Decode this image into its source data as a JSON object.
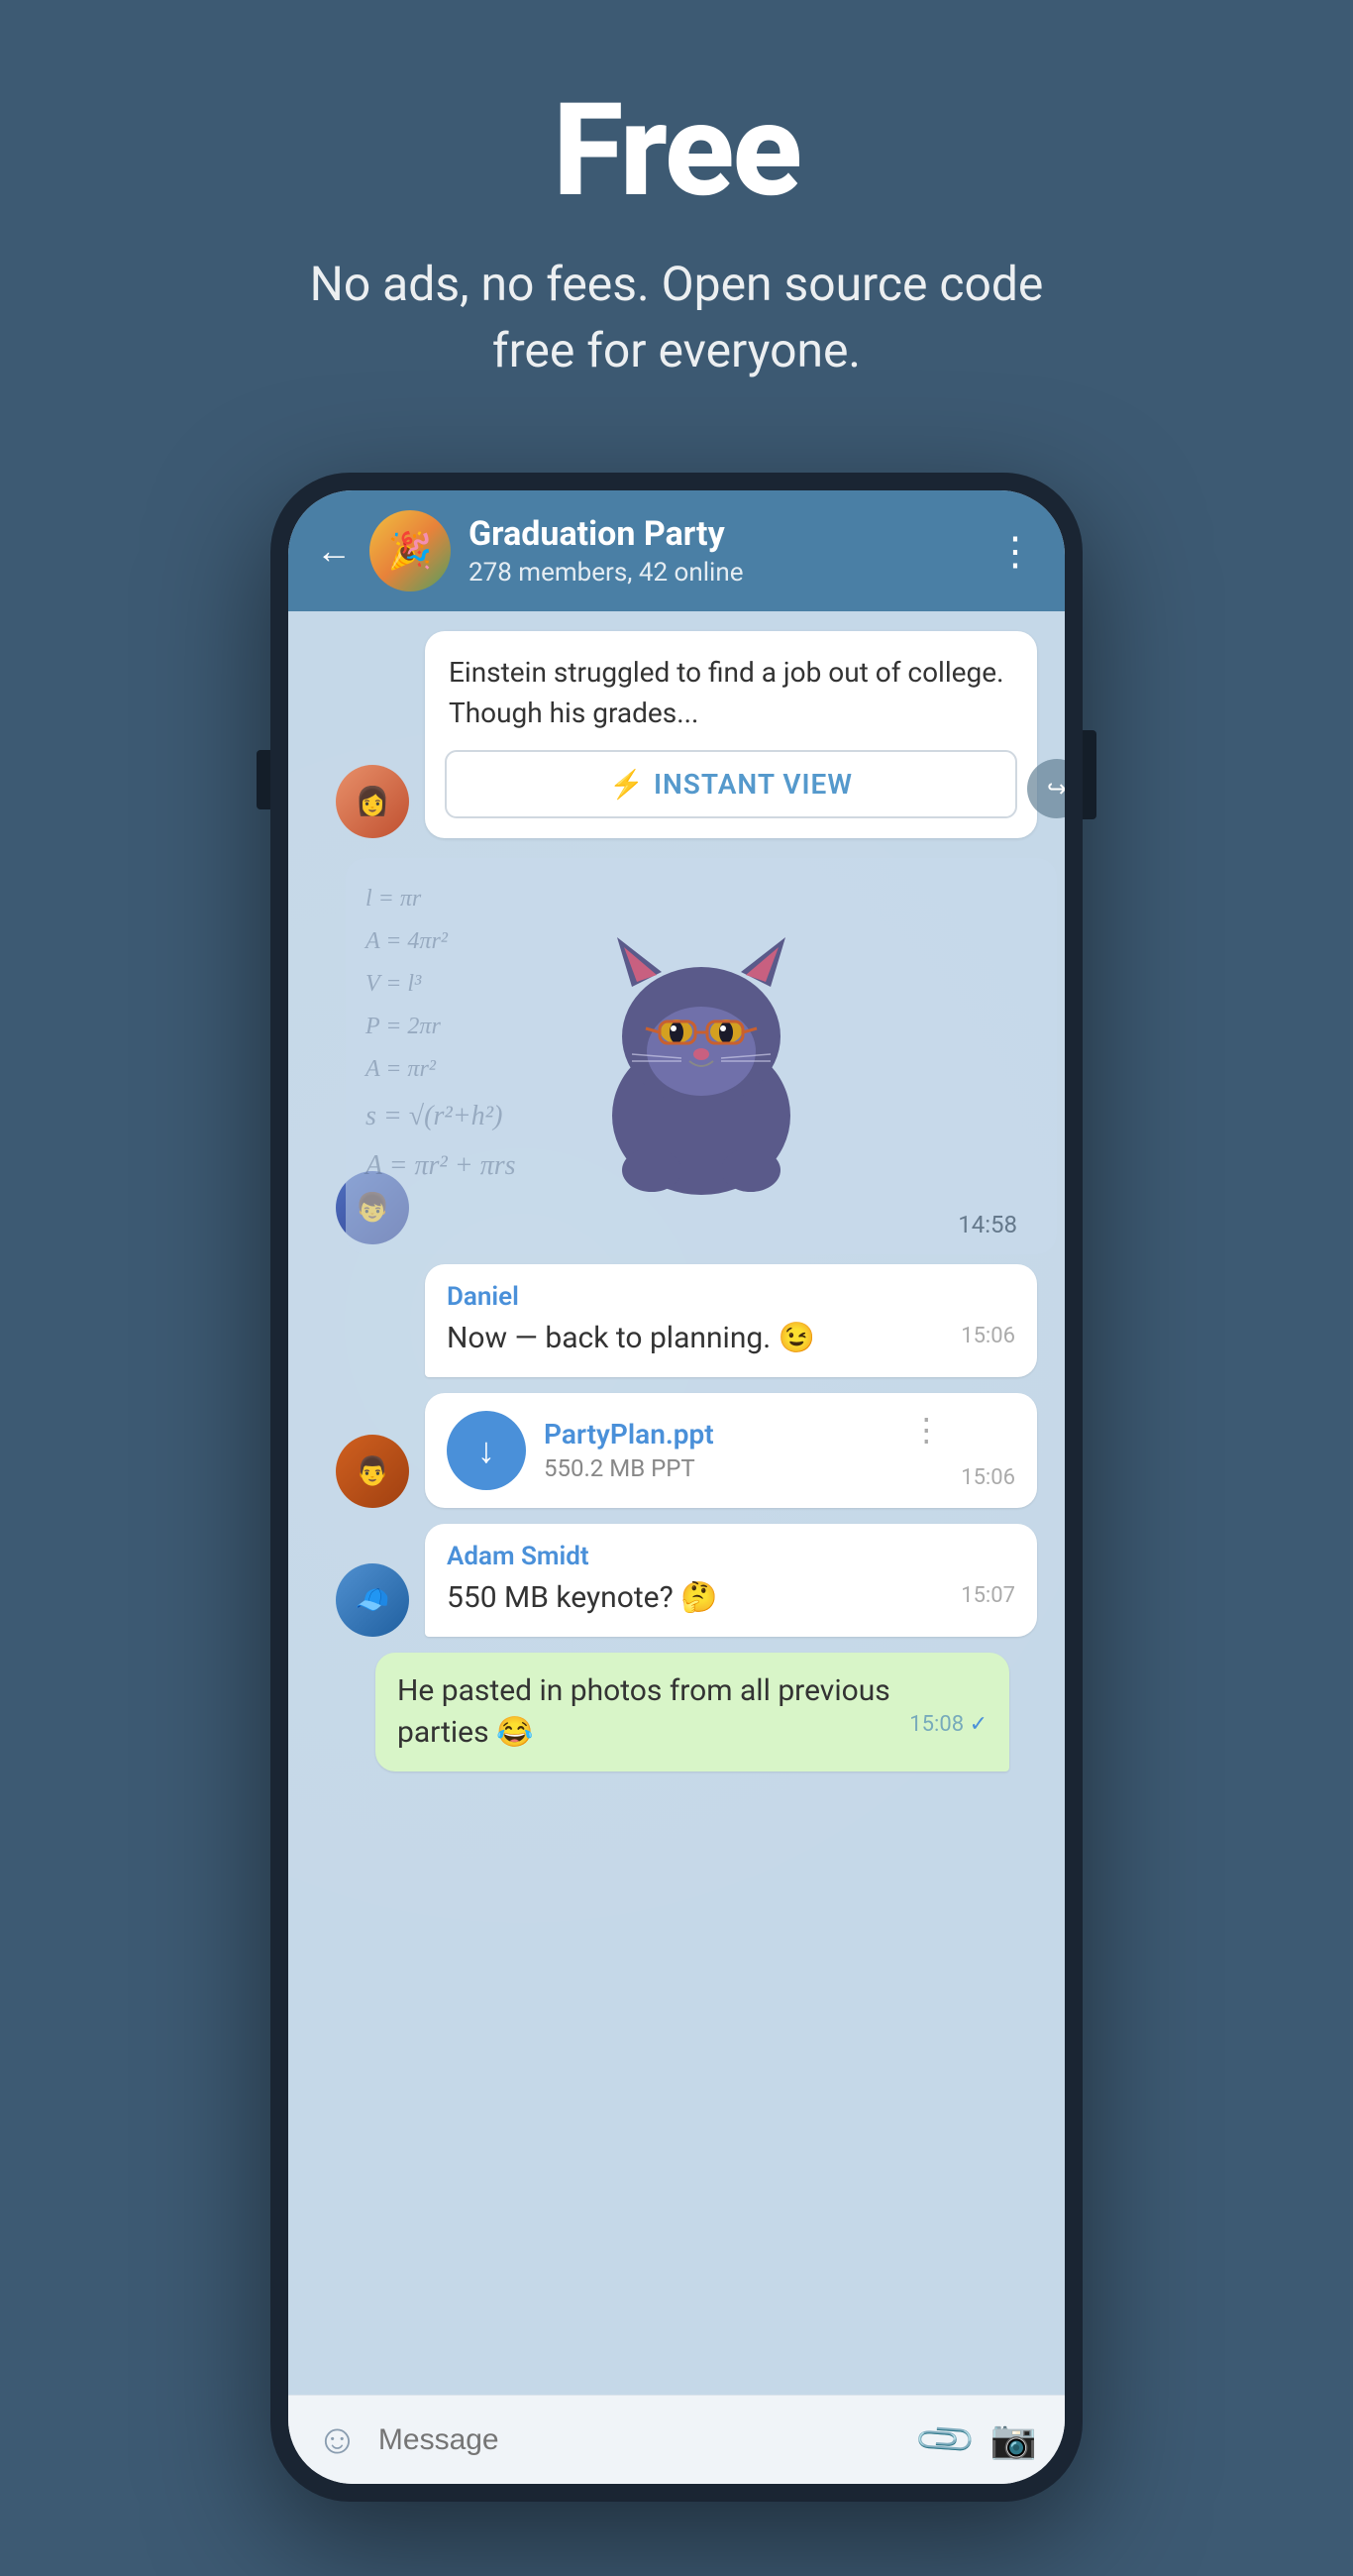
{
  "hero": {
    "title": "Free",
    "subtitle": "No ads, no fees. Open source code free for everyone."
  },
  "chat_header": {
    "group_name": "Graduation Party",
    "members": "278 members, 42 online",
    "back_label": "←",
    "more_label": "⋮"
  },
  "article": {
    "text": "Einstein struggled to find a job out of college. Though his grades...",
    "instant_view_label": "INSTANT VIEW"
  },
  "sticker": {
    "time": "14:58"
  },
  "messages": [
    {
      "sender": "Daniel",
      "text": "Now — back to planning. 😉",
      "time": "15:06",
      "type": "received"
    }
  ],
  "file": {
    "name": "PartyPlan.ppt",
    "size": "550.2 MB PPT",
    "time": "15:06"
  },
  "messages2": [
    {
      "sender": "Adam Smidt",
      "text": "550 MB keynote? 🤔",
      "time": "15:07",
      "type": "received"
    }
  ],
  "self_message": {
    "text": "He pasted in photos from all previous parties 😂",
    "time": "15:08",
    "type": "sent"
  },
  "input": {
    "placeholder": "Message"
  }
}
